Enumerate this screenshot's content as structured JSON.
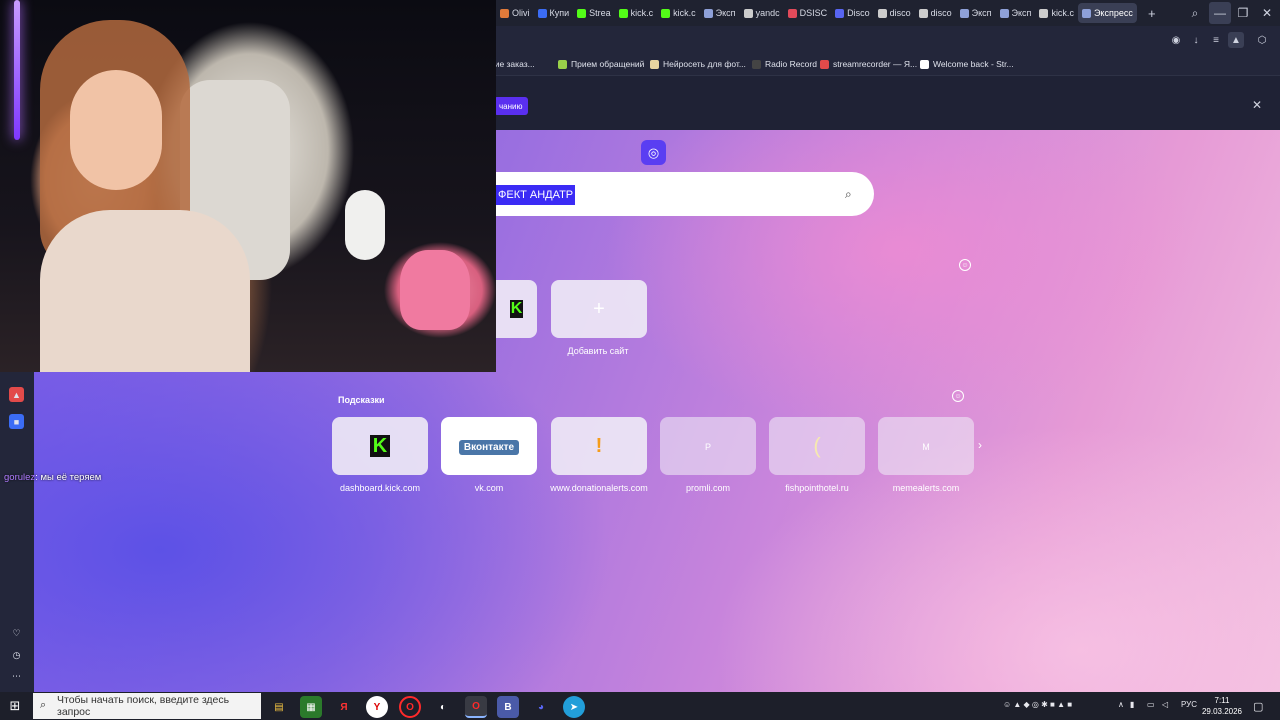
{
  "browser": {
    "tabs": [
      {
        "label": "Olivi",
        "color": "#e07a3a",
        "active": false
      },
      {
        "label": "Купи",
        "color": "#3b6cf5",
        "active": false
      },
      {
        "label": "Strea",
        "color": "#53fc18",
        "active": false
      },
      {
        "label": "kick.c",
        "color": "#53fc18",
        "active": false
      },
      {
        "label": "kick.c",
        "color": "#53fc18",
        "active": false
      },
      {
        "label": "Эксп",
        "color": "#8ea0d8",
        "active": false
      },
      {
        "label": "yandc",
        "color": "#cccccc",
        "active": false
      },
      {
        "label": "DSISC",
        "color": "#e24a5a",
        "active": false
      },
      {
        "label": "Disco",
        "color": "#5865f2",
        "active": false
      },
      {
        "label": "disco",
        "color": "#cccccc",
        "active": false
      },
      {
        "label": "disco",
        "color": "#cccccc",
        "active": false
      },
      {
        "label": "Эксп",
        "color": "#8ea0d8",
        "active": false
      },
      {
        "label": "Эксп",
        "color": "#8ea0d8",
        "active": false
      },
      {
        "label": "kick.c",
        "color": "#cccccc",
        "active": false
      },
      {
        "label": "Экспресс",
        "color": "#8ea0d8",
        "active": true
      }
    ],
    "new_tab": "+",
    "bookmarks": [
      {
        "label": "вление заказ...",
        "color": "#aaaaaa"
      },
      {
        "label": "Прием обращений",
        "color": "#9ad14a"
      },
      {
        "label": "Нейросеть для фот...",
        "color": "#e8d4a0"
      },
      {
        "label": "Radio Record",
        "color": "#444444"
      },
      {
        "label": "streamrecorder — Я...",
        "color": "#e24a4a"
      },
      {
        "label": "Welcome back - Str...",
        "color": "#ffffff"
      }
    ],
    "notification_button": "чанию"
  },
  "search": {
    "selected_text": "ФЕКТ АНДАТР"
  },
  "speed_dial": {
    "add_site_label": "Добавить сайт",
    "suggestions_title": "Подсказки",
    "suggestions": [
      {
        "label": "dashboard.kick.com",
        "icon": "kick-icon",
        "text": "K"
      },
      {
        "label": "vk.com",
        "icon": "vk-icon",
        "text": "Вконтакте"
      },
      {
        "label": "www.donationalerts.com",
        "icon": "donationalerts-icon",
        "text": "!"
      },
      {
        "label": "promli.com",
        "icon": "promli-icon",
        "text": "P"
      },
      {
        "label": "fishpointhotel.ru",
        "icon": "fishpoint-icon",
        "text": "("
      },
      {
        "label": "memealerts.com",
        "icon": "memealerts-icon",
        "text": "M"
      }
    ]
  },
  "chat": {
    "user": "gorulez",
    "message": ": мы её теряем"
  },
  "taskbar": {
    "search_placeholder": "Чтобы начать поиск, введите здесь запрос",
    "language": "РУС",
    "time": "7:11",
    "date": "29.03.2026"
  }
}
